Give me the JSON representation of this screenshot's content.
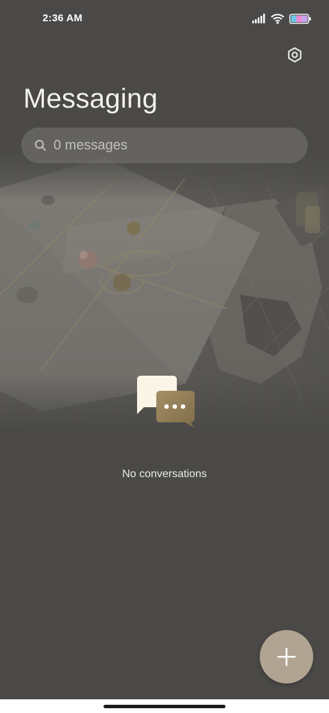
{
  "status_bar": {
    "time": "2:36 AM",
    "icons": [
      "signal-icon",
      "wifi-icon",
      "battery-icon"
    ]
  },
  "header": {
    "title": "Messaging",
    "settings_icon": "settings-icon"
  },
  "search": {
    "placeholder": "0 messages",
    "icon": "search-icon"
  },
  "empty_state": {
    "icon": "chat-bubbles-icon",
    "text": "No conversations"
  },
  "fab": {
    "icon": "plus-icon",
    "color": "#b1a392"
  },
  "colors": {
    "background": "#4a4947",
    "accent": "#b1a392"
  }
}
